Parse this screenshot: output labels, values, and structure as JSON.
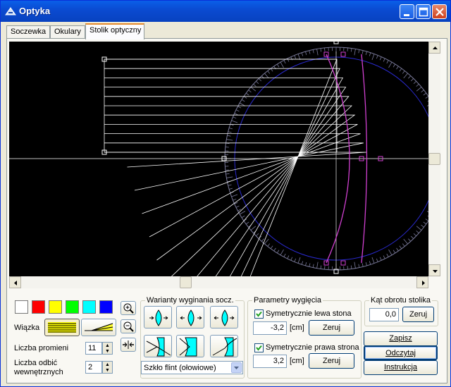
{
  "window": {
    "title": "Optyka"
  },
  "tabs": [
    {
      "label": "Soczewka",
      "active": false
    },
    {
      "label": "Okulary",
      "active": false
    },
    {
      "label": "Stolik optyczny",
      "active": true
    }
  ],
  "beam": {
    "colors": [
      "#ffffff",
      "#ff0000",
      "#ffff00",
      "#00ff00",
      "#00ffff",
      "#0000ff"
    ],
    "label": "Wiązka",
    "ray_count_label": "Liczba promieni",
    "ray_count": "11",
    "internal_reflections_label_line1": "Liczba odbić",
    "internal_reflections_label_line2": "wewnętrznych",
    "internal_reflections": "2"
  },
  "bending": {
    "title": "Warianty wyginania socz.",
    "material": "Szkło flint (ołowiowe)"
  },
  "params": {
    "title": "Parametry wygięcia",
    "left_label": "Symetrycznie lewa stona",
    "left_checked": true,
    "left_value": "-3,2",
    "right_label": "Symetrycznie prawa strona",
    "right_checked": true,
    "right_value": "3,2",
    "unit": "[cm]",
    "reset_label": "Zeruj"
  },
  "rotation": {
    "title": "Kąt obrotu stolika",
    "value": "0,0",
    "reset_label": "Zeruj"
  },
  "actions": {
    "save": "Zapisz",
    "read": "Odczytaj",
    "instruction": "Instrukcja"
  },
  "colors": {
    "lens": "#d040d0",
    "rays": "#ffffff",
    "protractor": "#7a7a9a",
    "circle": "#2a2ad0"
  }
}
